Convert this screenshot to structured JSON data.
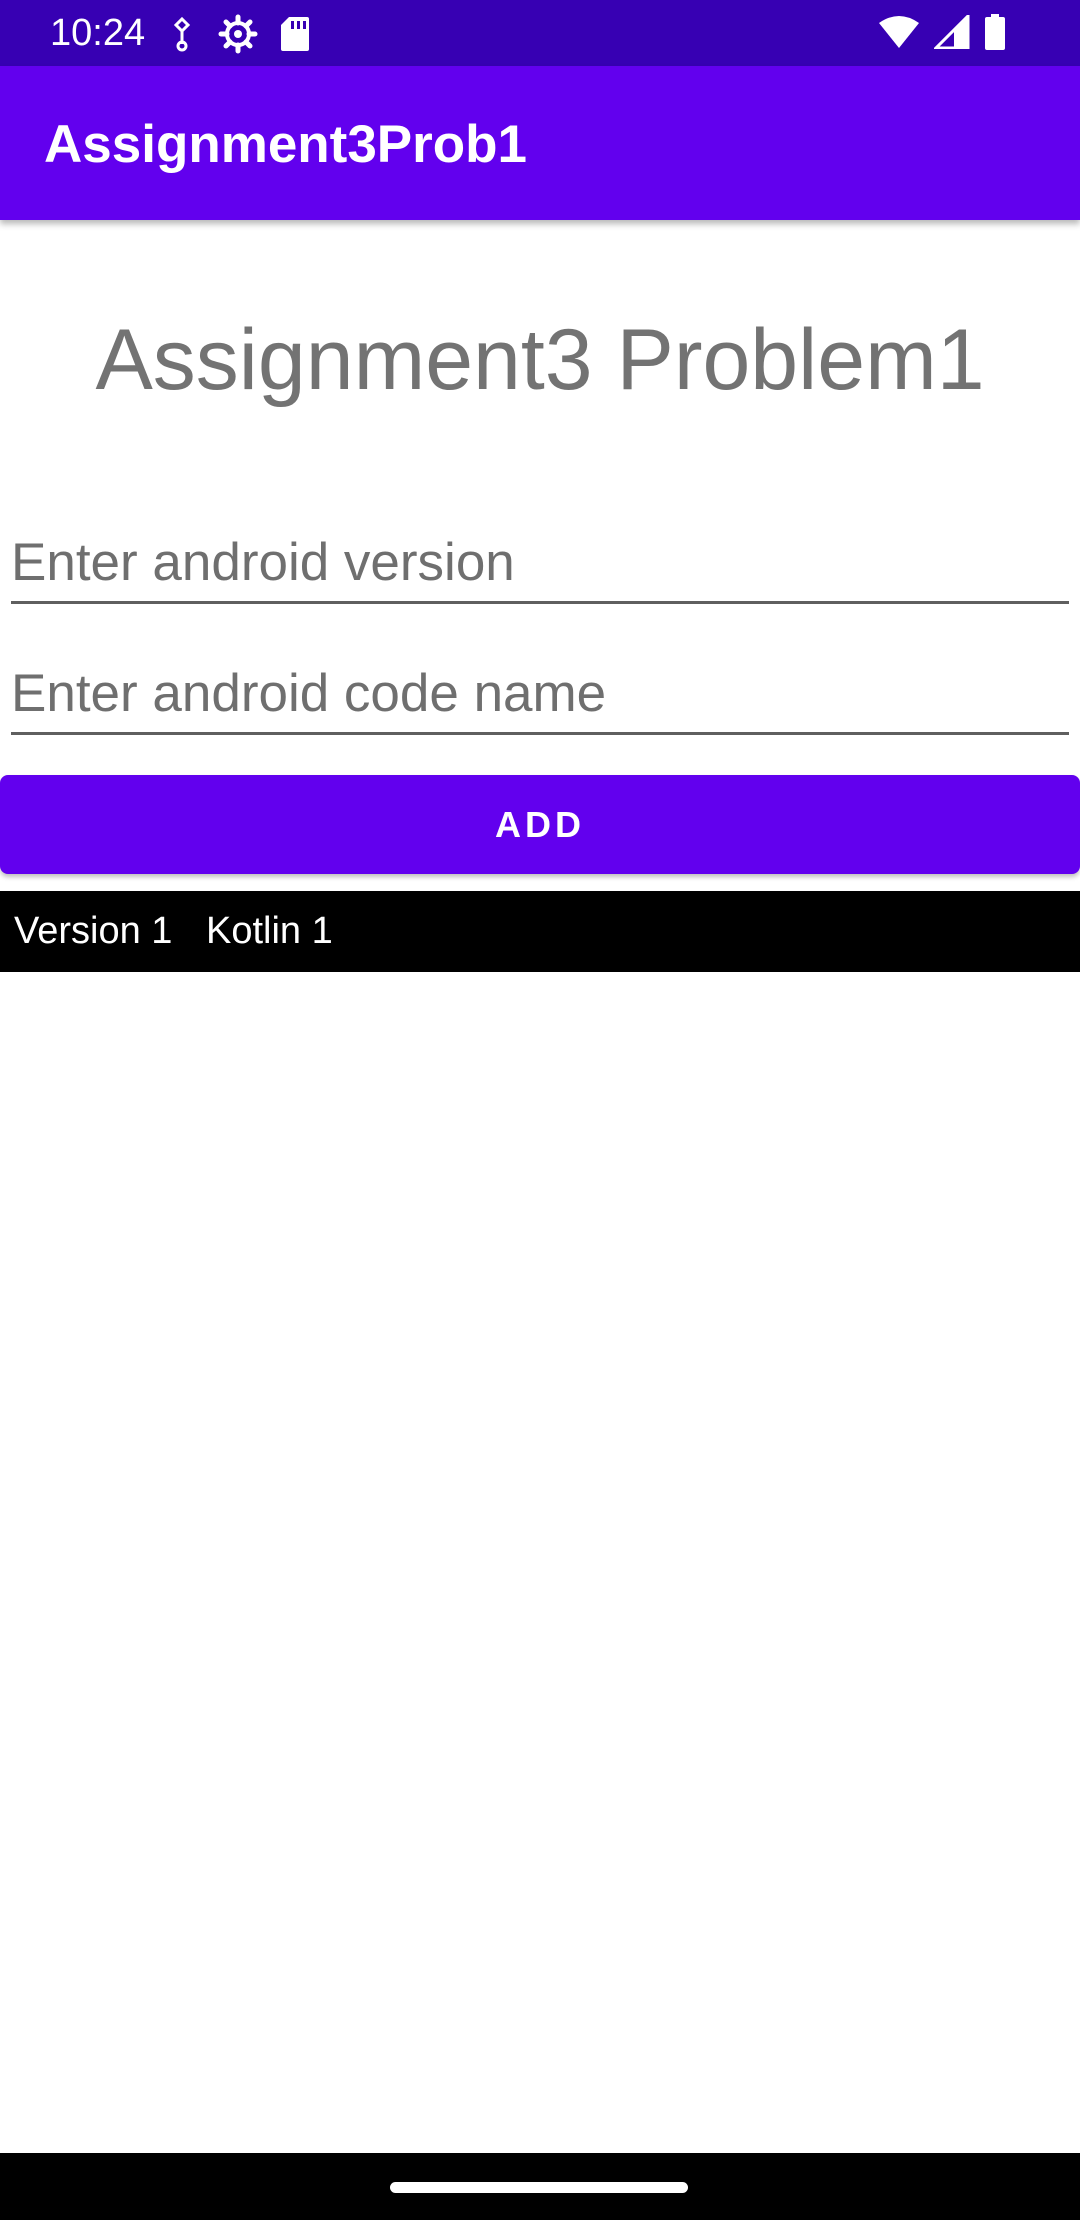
{
  "status_bar": {
    "time": "10:24",
    "left_icons": [
      "usb-debug-icon",
      "settings-icon",
      "sd-card-icon"
    ],
    "right_icons": [
      "wifi-icon",
      "signal-icon",
      "battery-icon"
    ]
  },
  "app_bar": {
    "title": "Assignment3Prob1"
  },
  "main": {
    "heading": "Assignment3 Problem1",
    "version_input": {
      "value": "",
      "placeholder": "Enter android version"
    },
    "codename_input": {
      "value": "",
      "placeholder": "Enter android code name"
    },
    "add_button_label": "ADD"
  },
  "list": {
    "items": [
      {
        "version": "Version 1",
        "codename": "Kotlin 1"
      }
    ]
  },
  "colors": {
    "status_bar": "#3700B3",
    "primary": "#6200EE",
    "row_background": "#000000"
  }
}
